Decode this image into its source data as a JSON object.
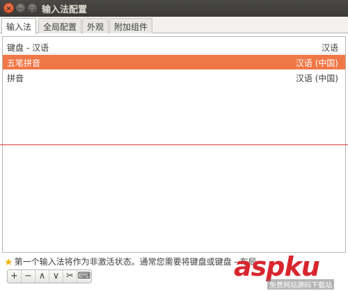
{
  "window": {
    "title": "输入法配置"
  },
  "tabs": [
    "输入法",
    "全局配置",
    "外观",
    "附加组件"
  ],
  "list": {
    "header": {
      "name": "键盘 - 汉语",
      "language": "汉语"
    },
    "items": [
      {
        "name": "五笔拼音",
        "language": "汉语 (中国)",
        "selected": true
      },
      {
        "name": "拼音",
        "language": "汉语 (中国)",
        "selected": false
      }
    ]
  },
  "status": {
    "text": "第一个输入法将作为非激活状态。通常您需要将键盘或键盘 - 布局"
  },
  "toolbar": {
    "add": "+",
    "remove": "−",
    "up": "∧",
    "down": "∨",
    "configure": "✂",
    "keyboard": "⌨"
  },
  "watermark": {
    "main": "aspku",
    "sub": "免费网站源码下载站"
  },
  "colors": {
    "selection": "#f07746",
    "titlebar": "#3c3b37",
    "close_button": "#e05a2f"
  }
}
